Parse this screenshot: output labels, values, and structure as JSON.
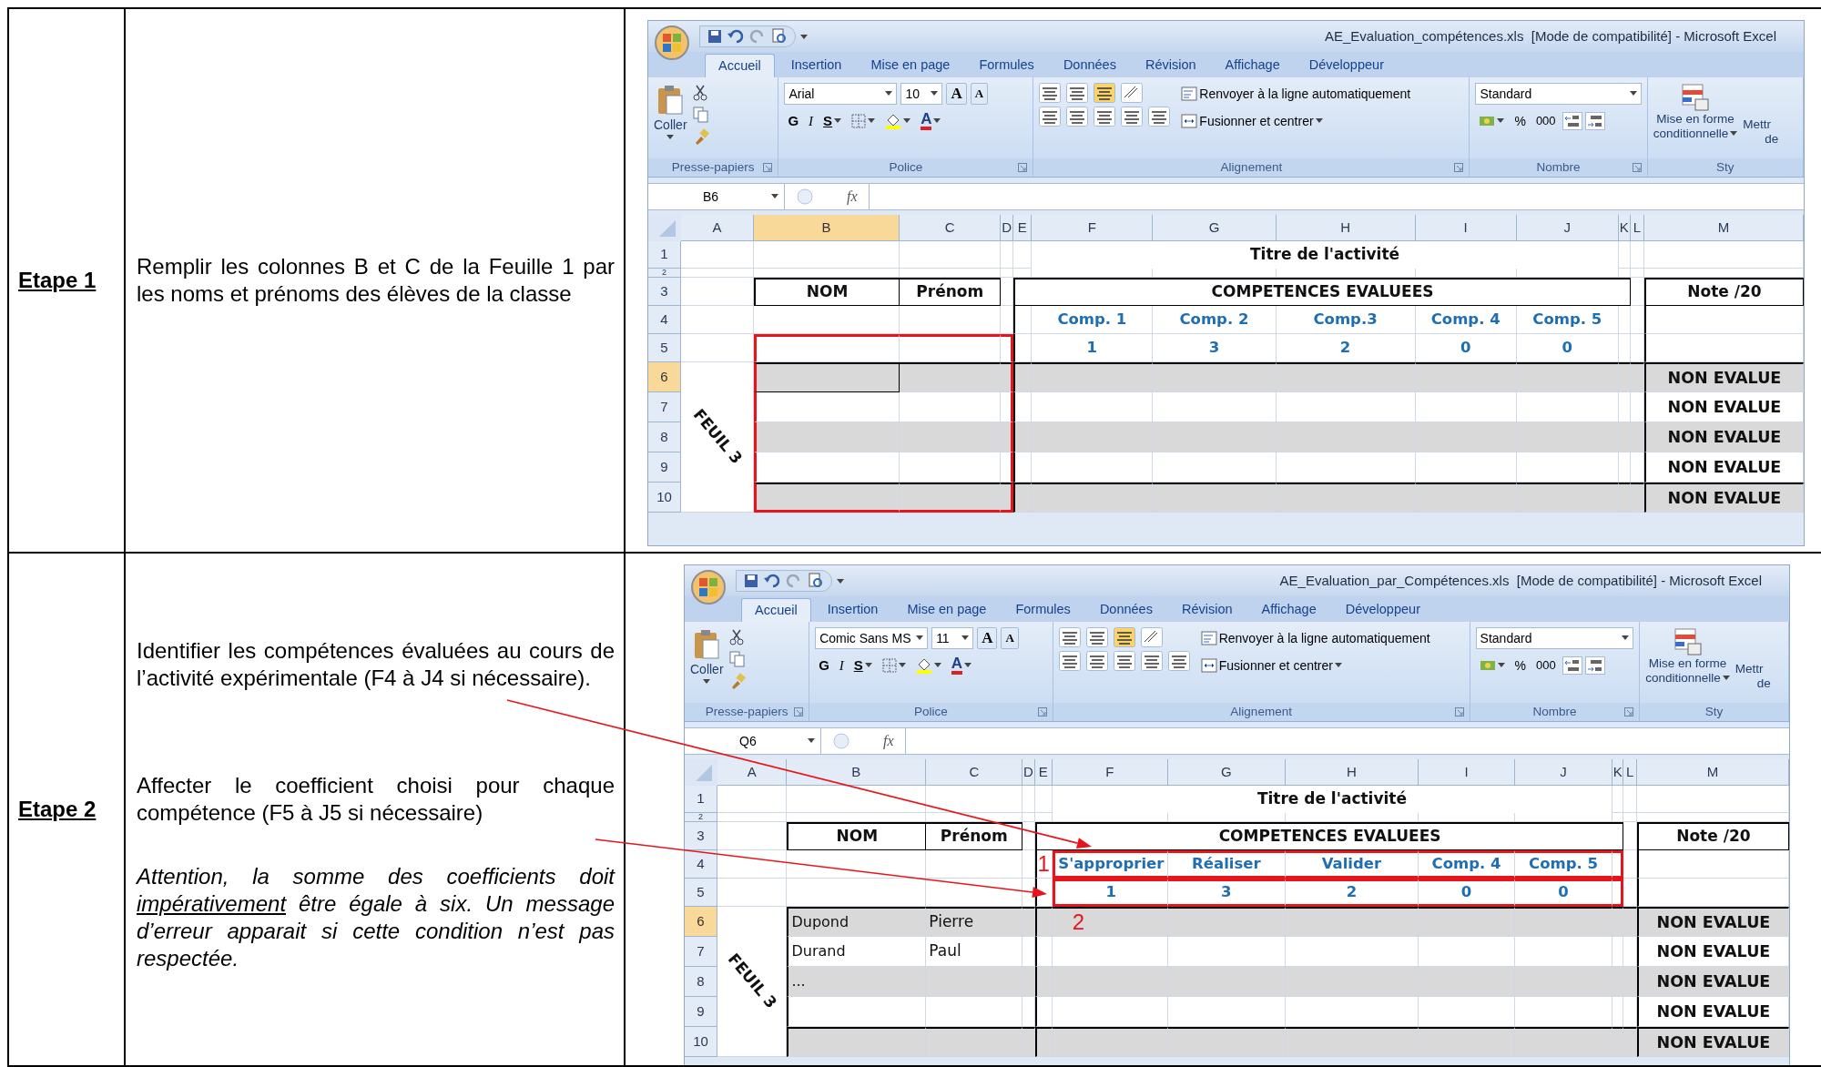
{
  "steps": [
    {
      "label": "Etape 1",
      "paragraphs": [
        {
          "kind": "instruction",
          "text": "Remplir les colonnes B et C de la Feuille 1 par les noms et prénoms des élèves de la classe"
        }
      ],
      "excel": {
        "title": "AE_Evaluation_compétences.xls  [Mode de compatibilité] - Microsoft Excel",
        "tabs": [
          {
            "label": "Accueil",
            "selected": true
          },
          {
            "label": "Insertion",
            "selected": false
          },
          {
            "label": "Mise en page",
            "selected": false
          },
          {
            "label": "Formules",
            "selected": false
          },
          {
            "label": "Données",
            "selected": false
          },
          {
            "label": "Révision",
            "selected": false
          },
          {
            "label": "Affichage",
            "selected": false
          },
          {
            "label": "Développeur",
            "selected": false
          }
        ],
        "ribbon": {
          "paste": "Coller",
          "font_name": "Arial",
          "font_size": "10",
          "font_grow": "A",
          "font_shrink": "A",
          "bold": "G",
          "italic": "I",
          "underline": "S",
          "font_color": "A",
          "wrap_text": "Renvoyer à la ligne automatiquement",
          "merge": "Fusionner et centrer",
          "number_format": "Standard",
          "percent": "%",
          "thousands": "000",
          "conditional_format": [
            "Mise en forme",
            "conditionnelle"
          ],
          "next_style": [
            "Mettr",
            "de"
          ],
          "groups": [
            "Presse-papiers",
            "Police",
            "Alignement",
            "Nombre",
            "Sty"
          ]
        },
        "name_box": "B6",
        "formula_label": "fx",
        "columns": [
          {
            "letter": "A",
            "selected": false
          },
          {
            "letter": "B",
            "selected": true
          },
          {
            "letter": "C",
            "selected": false
          },
          {
            "letter": "D",
            "selected": false
          },
          {
            "letter": "E",
            "selected": false
          },
          {
            "letter": "F",
            "selected": false
          },
          {
            "letter": "G",
            "selected": false
          },
          {
            "letter": "H",
            "selected": false
          },
          {
            "letter": "I",
            "selected": false
          },
          {
            "letter": "J",
            "selected": false
          },
          {
            "letter": "K",
            "selected": false
          },
          {
            "letter": "L",
            "selected": false
          },
          {
            "letter": "M",
            "selected": false
          }
        ],
        "rows": [
          {
            "number": "1",
            "selected": false
          },
          {
            "number": "2",
            "selected": false
          },
          {
            "number": "3",
            "selected": false
          },
          {
            "number": "4",
            "selected": false
          },
          {
            "number": "5",
            "selected": false
          },
          {
            "number": "6",
            "selected": true
          },
          {
            "number": "7",
            "selected": false
          },
          {
            "number": "8",
            "selected": false
          },
          {
            "number": "9",
            "selected": false
          },
          {
            "number": "10",
            "selected": false
          }
        ],
        "sheet": {
          "title": "Titre de l'activité",
          "nom": "NOM",
          "prenom": "Prénom",
          "competences": "COMPETENCES EVALUEES",
          "note": "Note /20",
          "sheet_label": "FEUIL 3",
          "skills": [
            {
              "label": "Comp. 1",
              "coefficient": "1"
            },
            {
              "label": "Comp. 2",
              "coefficient": "3"
            },
            {
              "label": "Comp.3",
              "coefficient": "2"
            },
            {
              "label": "Comp. 4",
              "coefficient": "0"
            },
            {
              "label": "Comp. 5",
              "coefficient": "0"
            }
          ],
          "results": [
            "NON EVALUE",
            "NON EVALUE",
            "NON EVALUE",
            "NON EVALUE",
            "NON EVALUE"
          ]
        },
        "markers": [
          {
            "kind": "names"
          }
        ]
      }
    },
    {
      "label": "Etape 2",
      "paragraphs": [
        {
          "kind": "instruction",
          "pointer": true,
          "text": "Identifier les compétences évaluées au cours de l’activité expérimentale (F4 à J4 si nécessaire)."
        },
        {
          "kind": "instruction",
          "pointer": true,
          "text": "Affecter le coefficient choisi pour chaque compétence (F5 à J5 si nécessaire)"
        },
        {
          "kind": "note",
          "segments": [
            {
              "text": "Attention, la somme des coefficients doit ",
              "underlined": false
            },
            {
              "text": "impérativement",
              "underlined": true
            },
            {
              "text": " être égale à six. Un message d’erreur apparait si cette condition n’est pas respectée.",
              "underlined": false
            }
          ]
        }
      ],
      "excel": {
        "title": "AE_Evaluation_par_Compétences.xls  [Mode de compatibilité] - Microsoft Excel",
        "tabs": [
          {
            "label": "Accueil",
            "selected": true
          },
          {
            "label": "Insertion",
            "selected": false
          },
          {
            "label": "Mise en page",
            "selected": false
          },
          {
            "label": "Formules",
            "selected": false
          },
          {
            "label": "Données",
            "selected": false
          },
          {
            "label": "Révision",
            "selected": false
          },
          {
            "label": "Affichage",
            "selected": false
          },
          {
            "label": "Développeur",
            "selected": false
          }
        ],
        "ribbon": {
          "paste": "Coller",
          "font_name": "Comic Sans MS",
          "font_size": "11",
          "font_grow": "A",
          "font_shrink": "A",
          "bold": "G",
          "italic": "I",
          "underline": "S",
          "font_color": "A",
          "wrap_text": "Renvoyer à la ligne automatiquement",
          "merge": "Fusionner et centrer",
          "number_format": "Standard",
          "percent": "%",
          "thousands": "000",
          "conditional_format": [
            "Mise en forme",
            "conditionnelle"
          ],
          "next_style": [
            "Mettr",
            "de"
          ],
          "groups": [
            "Presse-papiers",
            "Police",
            "Alignement",
            "Nombre",
            "Sty"
          ]
        },
        "name_box": "Q6",
        "formula_label": "fx",
        "columns": [
          {
            "letter": "A",
            "selected": false
          },
          {
            "letter": "B",
            "selected": false
          },
          {
            "letter": "C",
            "selected": false
          },
          {
            "letter": "D",
            "selected": false
          },
          {
            "letter": "E",
            "selected": false
          },
          {
            "letter": "F",
            "selected": false
          },
          {
            "letter": "G",
            "selected": false
          },
          {
            "letter": "H",
            "selected": false
          },
          {
            "letter": "I",
            "selected": false
          },
          {
            "letter": "J",
            "selected": false
          },
          {
            "letter": "K",
            "selected": false
          },
          {
            "letter": "L",
            "selected": false
          },
          {
            "letter": "M",
            "selected": false
          }
        ],
        "rows": [
          {
            "number": "1",
            "selected": false
          },
          {
            "number": "2",
            "selected": false
          },
          {
            "number": "3",
            "selected": false
          },
          {
            "number": "4",
            "selected": false
          },
          {
            "number": "5",
            "selected": false
          },
          {
            "number": "6",
            "selected": true
          },
          {
            "number": "7",
            "selected": false
          },
          {
            "number": "8",
            "selected": false
          },
          {
            "number": "9",
            "selected": false
          },
          {
            "number": "10",
            "selected": false
          }
        ],
        "sheet": {
          "title": "Titre de l'activité",
          "nom": "NOM",
          "prenom": "Prénom",
          "competences": "COMPETENCES EVALUEES",
          "note": "Note /20",
          "sheet_label": "FEUIL 3",
          "skills": [
            {
              "label": "S'approprier",
              "coefficient": "1"
            },
            {
              "label": "Réaliser",
              "coefficient": "3"
            },
            {
              "label": "Valider",
              "coefficient": "2"
            },
            {
              "label": "Comp. 4",
              "coefficient": "0"
            },
            {
              "label": "Comp. 5",
              "coefficient": "0"
            }
          ],
          "students": [
            {
              "nom": "Dupond",
              "prenom": "Pierre"
            },
            {
              "nom": "Durand",
              "prenom": "Paul"
            },
            {
              "nom": "..."
            }
          ],
          "results": [
            "NON EVALUE",
            "NON EVALUE",
            "NON EVALUE",
            "NON EVALUE",
            "NON EVALUE"
          ]
        },
        "markers": [
          {
            "kind": "competences",
            "label": "1"
          },
          {
            "kind": "coefficients",
            "label": "2"
          }
        ]
      }
    }
  ]
}
